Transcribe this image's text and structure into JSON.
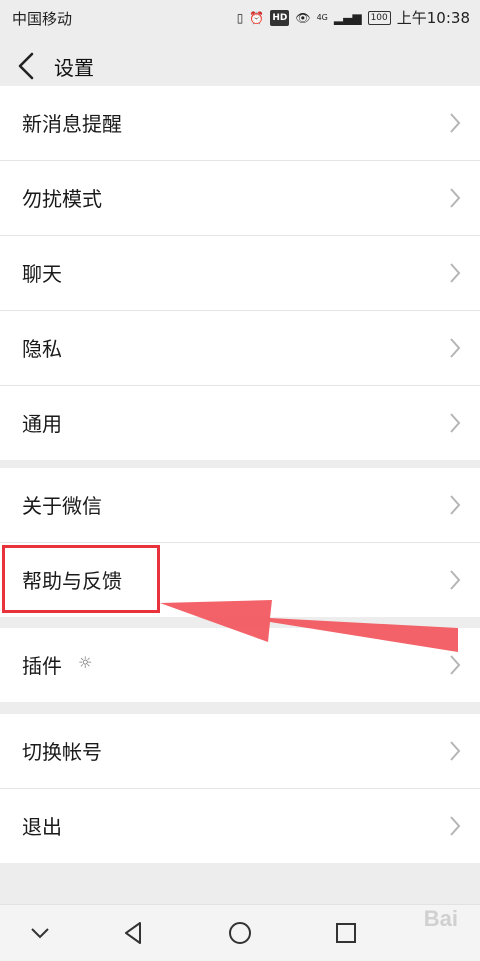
{
  "status": {
    "carrier": "中国移动",
    "network": "4G",
    "hd": "HD",
    "battery": "100",
    "time": "上午10:38"
  },
  "header": {
    "title": "设置"
  },
  "groups": [
    {
      "items": [
        {
          "label": "新消息提醒"
        },
        {
          "label": "勿扰模式"
        },
        {
          "label": "聊天"
        },
        {
          "label": "隐私"
        },
        {
          "label": "通用"
        }
      ]
    },
    {
      "items": [
        {
          "label": "关于微信"
        },
        {
          "label": "帮助与反馈"
        }
      ]
    },
    {
      "items": [
        {
          "label": "插件"
        }
      ]
    },
    {
      "items": [
        {
          "label": "切换帐号"
        },
        {
          "label": "退出"
        }
      ]
    }
  ],
  "watermark": "Bai"
}
